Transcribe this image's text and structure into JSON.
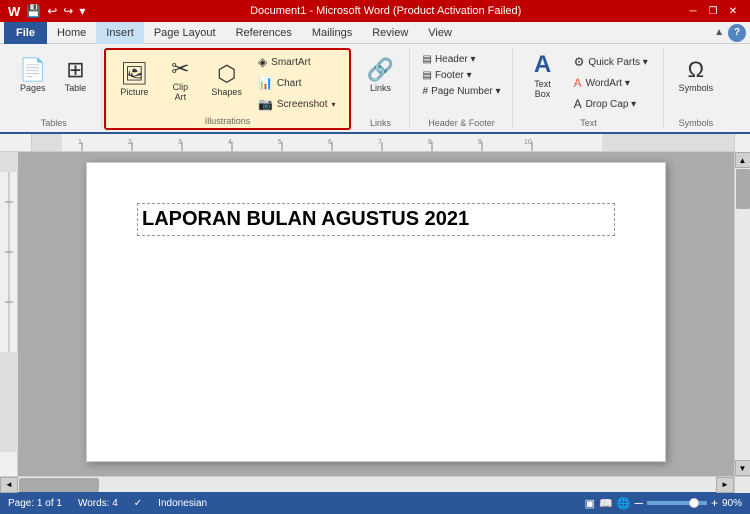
{
  "titleBar": {
    "title": "Document1 - Microsoft Word (Product Activation Failed)",
    "wordIcon": "W",
    "minimize": "─",
    "restore": "❐",
    "close": "✕"
  },
  "menuBar": {
    "file": "File",
    "items": [
      "Home",
      "Insert",
      "Page Layout",
      "References",
      "Mailings",
      "Review",
      "View"
    ]
  },
  "quickAccess": {
    "buttons": [
      "💾",
      "↩",
      "↪",
      "✎"
    ]
  },
  "ribbon": {
    "activeTab": "Insert",
    "groups": {
      "tables": {
        "label": "Tables",
        "buttons": [
          {
            "icon": "📄",
            "label": "Pages"
          },
          {
            "icon": "⊞",
            "label": "Table"
          }
        ]
      },
      "illustrations": {
        "label": "Illustrations",
        "highlighted": true,
        "largeButtons": [
          {
            "icon": "🖼",
            "label": "Picture"
          },
          {
            "icon": "✂",
            "label": "Clip Art"
          },
          {
            "icon": "⬡",
            "label": "Shapes"
          }
        ],
        "smallButtons": [
          {
            "icon": "◈",
            "label": "SmartArt"
          },
          {
            "icon": "📊",
            "label": "Chart"
          },
          {
            "icon": "📷",
            "label": "Screenshot"
          }
        ]
      },
      "links": {
        "label": "Links",
        "buttons": [
          {
            "icon": "🔗",
            "label": "Links"
          }
        ]
      },
      "headerFooter": {
        "label": "Header & Footer",
        "rows": [
          {
            "icon": "▤",
            "label": "Header ▾"
          },
          {
            "icon": "▤",
            "label": "Footer ▾"
          },
          {
            "icon": "#",
            "label": "Page Number ▾"
          }
        ]
      },
      "text": {
        "label": "Text",
        "largeButtons": [
          {
            "icon": "A",
            "label": "Text Box"
          }
        ],
        "smallButtons": [
          {
            "icon": "⚙",
            "label": "Quick Parts ▾"
          },
          {
            "icon": "A",
            "label": "WordArt ▾"
          },
          {
            "icon": "A",
            "label": "Drop Cap ▾"
          }
        ]
      },
      "symbols": {
        "label": "Symbols",
        "buttons": [
          {
            "icon": "Ω",
            "label": "Symbols"
          }
        ]
      }
    }
  },
  "document": {
    "content": "LAPORAN BULAN AGUSTUS 2021"
  },
  "statusBar": {
    "page": "Page: 1 of 1",
    "words": "Words: 4",
    "language": "Indonesian",
    "zoom": "90%"
  }
}
